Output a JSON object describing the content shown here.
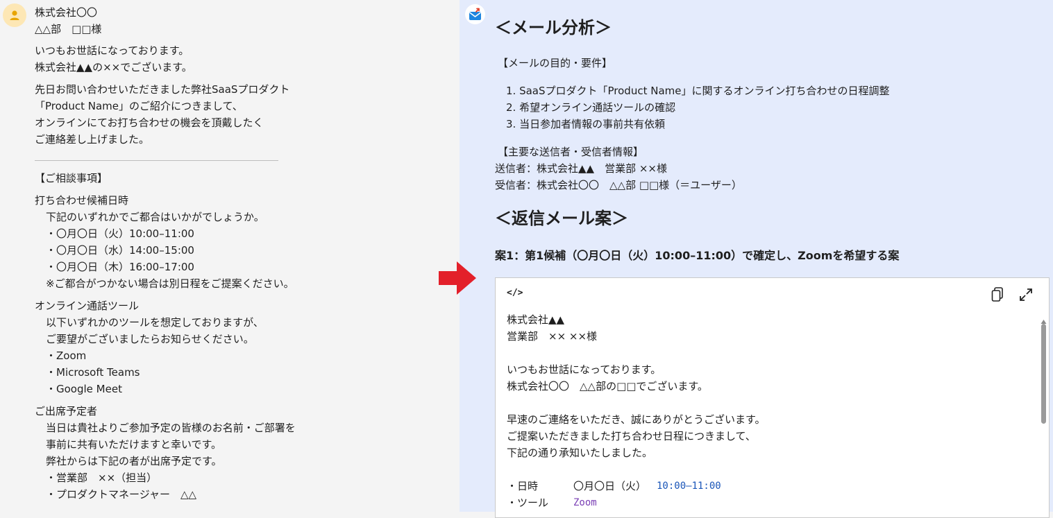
{
  "left": {
    "lines": [
      "株式会社〇〇",
      "△△部　□□様",
      "いつもお世話になっております。",
      "株式会社▲▲の××でございます。",
      "先日お問い合わせいただきました弊社SaaSプロダクト",
      "「Product Name」のご紹介につきまして、",
      "オンラインにてお打ち合わせの機会を頂戴したく",
      "ご連絡差し上げました。",
      "【ご相談事項】",
      "打ち合わせ候補日時",
      "下記のいずれかでご都合はいかがでしょうか。",
      "・〇月〇日（火）10:00–11:00",
      "・〇月〇日（水）14:00–15:00",
      "・〇月〇日（木）16:00–17:00",
      "※ご都合がつかない場合は別日程をご提案ください。",
      "オンライン通話ツール",
      "以下いずれかのツールを想定しておりますが、",
      "ご要望がございましたらお知らせください。",
      "・Zoom",
      "・Microsoft Teams",
      "・Google Meet",
      "ご出席予定者",
      "当日は貴社よりご参加予定の皆様のお名前・ご部署を",
      "事前に共有いただけますと幸いです。",
      "弊社からは下記の者が出席予定です。",
      "・営業部　××（担当）",
      "・プロダクトマネージャー　△△"
    ]
  },
  "right": {
    "analysis_heading": "＜メール分析＞",
    "purpose_heading": "【メールの目的・要件】",
    "purpose_items": [
      "1. SaaSプロダクト「Product Name」に関するオンライン打ち合わせの日程調整",
      "2. 希望オンライン通話ツールの確認",
      "3. 当日参加者情報の事前共有依頼"
    ],
    "parties_heading": "【主要な送信者・受信者情報】",
    "sender": "送信者：株式会社▲▲　営業部 ××様",
    "receiver": "受信者：株式会社〇〇　△△部 □□様（＝ユーザー）",
    "reply_heading": "＜返信メール案＞",
    "draft1_title": "案1：第1候補（〇月〇日（火）10:00–11:00）で確定し、Zoomを希望する案",
    "code": {
      "lang_icon": "</>",
      "lines": [
        "株式会社▲▲",
        "営業部　××  ××様",
        "いつもお世話になっております。",
        "株式会社〇〇　△△部の□□でございます。",
        "早速のご連絡をいただき、誠にありがとうございます。",
        "ご提案いただきました打ち合わせ日程につきまして、",
        "下記の通り承知いたしました。"
      ],
      "date_label": "・日時",
      "date_value": "〇月〇日（火）",
      "time_value": "10:00–11:00",
      "tool_label": "・ツール",
      "tool_value": "Zoom"
    }
  },
  "colors": {
    "left_bg": "#f4f4f4",
    "right_bg": "#e4ebfc",
    "arrow": "#e3202a",
    "code_time": "#1a55b8",
    "code_tool": "#7a3fb5"
  }
}
